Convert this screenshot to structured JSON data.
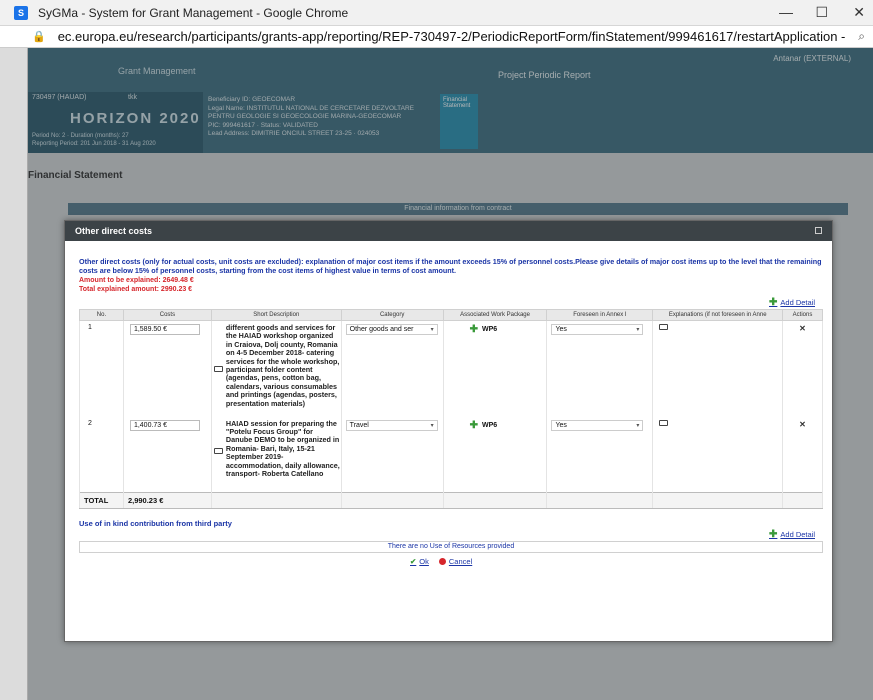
{
  "browser": {
    "title": "SyGMa - System for Grant Management - Google Chrome",
    "url": "ec.europa.eu/research/participants/grants-app/reporting/REP-730497-2/PeriodicReportForm/finStatement/999461617/restartApplication -"
  },
  "app": {
    "grant_management": "Grant Management",
    "page_header": "Project Periodic Report",
    "user": "Antanar (EXTERNAL)",
    "project_number": "730497 (HAUAD)",
    "acronym": "tkk",
    "programme": "HORIZON 2020",
    "period": "Period No: 2 · Duration (months): 27",
    "reporting_period": "Reporting Period: 201 Jun 2018 - 31 Aug 2020",
    "beneficiary": "Beneficiary ID: GEOECOMAR\nLegal Name: INSTITUTUL NATIONAL DE CERCETARE DEZVOLTARE PENTRU GEOLOGIE SI GEOECOLOGIE MARINA-GEOECOMAR\nPIC: 999461617 · Status: VALIDATED\nLead Address: DIMITRIE ONCIUL STREET 23-25 · 024053",
    "financial_tab": "Financial Statement",
    "financial_statement_title": "Financial Statement",
    "financial_info_bar": "Financial information from contract"
  },
  "modal": {
    "title": "Other direct costs",
    "intro": "Other direct costs (only for actual costs, unit costs are excluded): explanation of major cost items if the amount exceeds 15% of personnel costs.Please give details of major cost items up to the level that the remaining costs are below 15% of personnel costs, starting from the cost items of highest value in terms of cost amount.",
    "amount_to_explain": "Amount to be explained: 2649.48 €",
    "total_explained": "Total explained amount: 2990.23 €",
    "add_detail_label": "Add Detail",
    "columns": [
      "No.",
      "Costs",
      "Short Description",
      "Category",
      "Associated Work Package",
      "Foreseen in Annex I",
      "Explanations (if not foreseen in Anne",
      "Actions"
    ],
    "rows": [
      {
        "no": "1",
        "cost": "1,589.50 €",
        "description": "different goods and services for the HAIAD workshop organized in Craiova, Dolj county, Romania on 4-5 December 2018- catering services for the whole workshop, participant folder content (agendas, pens, cotton bag, calendars, various consumables and printings (agendas, posters, presentation materials)",
        "category": "Other goods and ser",
        "work_package": "WP6",
        "foreseen": "Yes",
        "action": "✕"
      },
      {
        "no": "2",
        "cost": "1,400.73 €",
        "description": "HAIAD session for preparing the \"Potelu Focus Group\" for Danube DEMO to be organized in Romania- Bari, Italy, 15-21 September 2019- accommodation, daily allowance, transport- Roberta Catellano",
        "category": "Travel",
        "work_package": "WP6",
        "foreseen": "Yes",
        "action": "✕"
      }
    ],
    "total_label": "TOTAL",
    "total_value": "2,990.23 €",
    "inkind_heading": "Use of in kind contribution from third party",
    "no_resources": "There are no Use of Resources provided",
    "ok_label": "Ok",
    "cancel_label": "Cancel"
  }
}
